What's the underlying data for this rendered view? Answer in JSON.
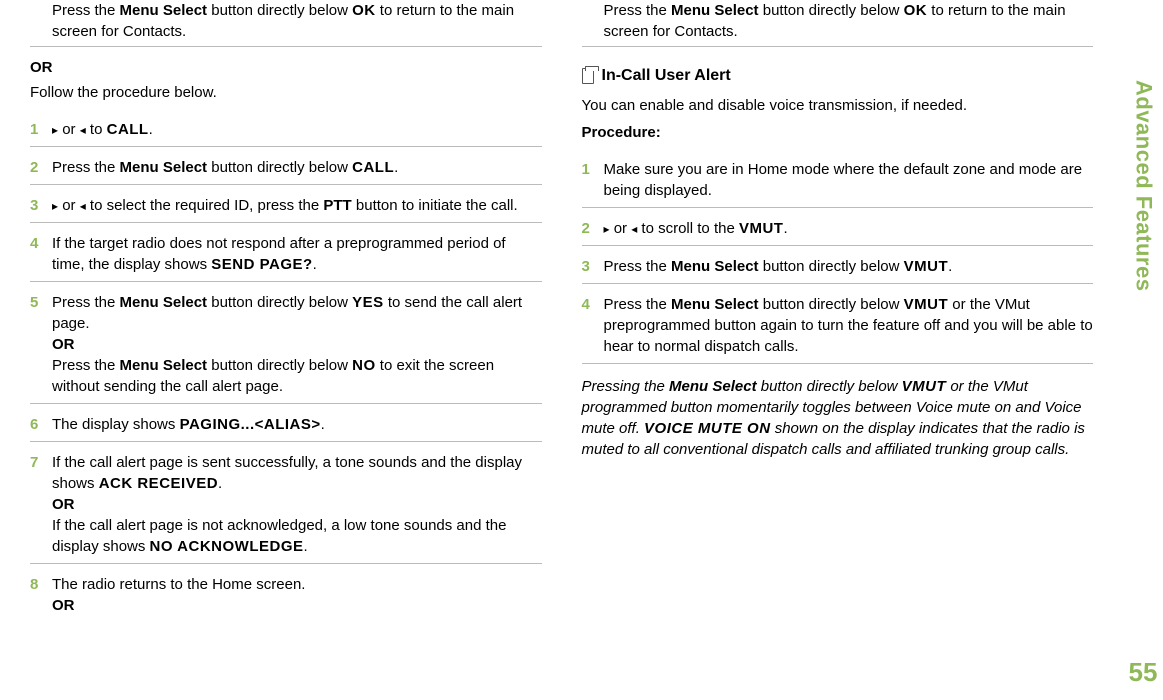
{
  "sidebar": {
    "title": "Advanced Features",
    "page": "55"
  },
  "left": {
    "intro_press": "Press the ",
    "menu_select": "Menu Select",
    "intro_below": " button directly below ",
    "ok": "OK",
    "intro_return": " to return to the main screen for Contacts.",
    "or": "OR",
    "follow": "Follow the procedure below.",
    "steps": {
      "1": {
        "or_text": " or ",
        "to_text": " to ",
        "call": "CALL",
        "dot": "."
      },
      "2": {
        "press": "Press the ",
        "below": " button directly below ",
        "call": "CALL",
        "dot": "."
      },
      "3": {
        "or_text": " or ",
        "select": " to select the required ID, press the ",
        "ptt": "PTT",
        "rest": " button to initiate the call."
      },
      "4": {
        "text1": "If the target radio does not respond after a preprogrammed period of time, the display shows ",
        "sendpage": "SEND PAGE?",
        "dot": "."
      },
      "5": {
        "press": "Press the ",
        "below": " button directly below ",
        "yes": "YES",
        "text1": " to send the call alert page.",
        "or": "OR",
        "no": "NO",
        "text2": " to exit the screen without sending the call alert page."
      },
      "6": {
        "text1": "The display shows ",
        "paging": "PAGING...<ALIAS>",
        "dot": "."
      },
      "7": {
        "text1": "If the call alert page is sent successfully, a tone sounds and the display shows ",
        "ack": "ACK RECEIVED",
        "dot": ".",
        "or": "OR",
        "text2": "If the call alert page is not acknowledged, a low tone sounds and the display shows ",
        "noack": "NO ACKNOWLEDGE"
      },
      "8": {
        "text1": "The radio returns to the Home screen.",
        "or": "OR"
      }
    }
  },
  "right": {
    "intro_press": "Press the ",
    "menu_select": "Menu Select",
    "intro_below": " button directly below ",
    "ok": "OK",
    "intro_return": " to return to the main screen for Contacts.",
    "sect_title": "In-Call User Alert",
    "sect_desc": "You can enable and disable voice transmission, if needed.",
    "procedure": "Procedure:",
    "steps": {
      "1": {
        "text": "Make sure you are in Home mode where the default zone and mode are being displayed."
      },
      "2": {
        "or_text": " or ",
        "scroll": " to scroll to the ",
        "vmut": "VMUT",
        "dot": "."
      },
      "3": {
        "press": "Press the ",
        "below": " button directly below ",
        "vmut": "VMUT",
        "dot": "."
      },
      "4": {
        "press": "Press the ",
        "below": " button directly below ",
        "vmut": "VMUT",
        "rest": " or the VMut preprogrammed button again to turn the feature off and you will be able to hear to normal dispatch calls."
      }
    },
    "note": {
      "t1": "Pressing the ",
      "ms": "Menu Select",
      "t2": " button directly below ",
      "vmut": "VMUT",
      "t3": " or the VMut programmed button momentarily toggles between Voice mute on and Voice mute off. ",
      "vmon": "VOICE MUTE ON",
      "t4": " shown on the display indicates that the radio is muted to all conventional dispatch calls and affiliated trunking group calls."
    }
  }
}
